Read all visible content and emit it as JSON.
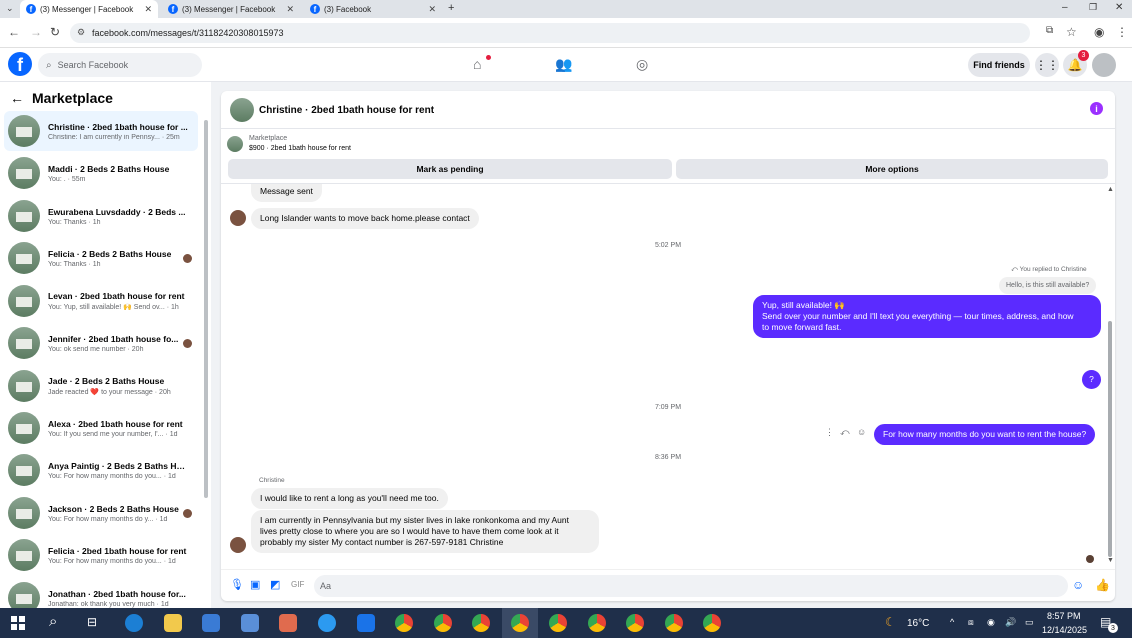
{
  "browser": {
    "tabs": [
      {
        "label": "(3) Messenger | Facebook"
      },
      {
        "label": "(3) Messenger | Facebook"
      },
      {
        "label": "(3) Facebook"
      }
    ],
    "url": "facebook.com/messages/t/31182420308015973"
  },
  "header": {
    "search_placeholder": "Search Facebook",
    "find_friends": "Find friends",
    "notification_count": "3"
  },
  "sidebar": {
    "title": "Marketplace",
    "conversations": [
      {
        "name": "Christine · 2bed 1bath house for ...",
        "preview": "Christine: I am currently in Pennsy... · 25m"
      },
      {
        "name": "Maddi · 2 Beds 2 Baths House",
        "preview": "You: . · 55m"
      },
      {
        "name": "Ewurabena Luvsdaddy · 2 Beds ...",
        "preview": "You: Thanks · 1h"
      },
      {
        "name": "Felicia · 2 Beds 2 Baths House",
        "preview": "You: Thanks · 1h"
      },
      {
        "name": "Levan · 2bed 1bath house for rent",
        "preview": "You: Yup, still available! 🙌 Send ov... · 1h"
      },
      {
        "name": "Jennifer · 2bed 1bath house fo...",
        "preview": "You: ok send me number · 20h"
      },
      {
        "name": "Jade · 2 Beds 2 Baths House",
        "preview": "Jade reacted ❤️ to your message · 20h"
      },
      {
        "name": "Alexa · 2bed 1bath house for rent",
        "preview": "You: If you send me your number, I'... · 1d"
      },
      {
        "name": "Anya Paintig · 2 Beds 2 Baths Ho...",
        "preview": "You: For how many months do you... · 1d"
      },
      {
        "name": "Jackson · 2 Beds 2 Baths House",
        "preview": "You: For how many months do y... · 1d"
      },
      {
        "name": "Felicia · 2bed 1bath house for rent",
        "preview": "You: For how many months do you... · 1d"
      },
      {
        "name": "Jonathan · 2bed 1bath house for...",
        "preview": "Jonathan: ok thank you very much · 1d"
      }
    ]
  },
  "chat": {
    "title": "Christine · 2bed 1bath house for rent",
    "listing_label": "Marketplace",
    "listing_detail": "$900 · 2bed 1bath house for rent",
    "mark_pending": "Mark as pending",
    "more_options": "More options",
    "messages": {
      "m1": "Message sent",
      "m2": "Long Islander wants to move back home.please contact",
      "ts1": "5:02 PM",
      "replied": "You replied to Christine",
      "quoted": "Hello, is this still available?",
      "m3_line1": "Yup, still available! 🙌",
      "m3_line2": "Send over your number and I'll text you everything — tour times, address, and how",
      "m3_line3": "to move forward fast.",
      "m4": "?",
      "ts2": "7:09 PM",
      "m5": "For how many months do you want to rent the house?",
      "ts3": "8:36 PM",
      "sender": "Christine",
      "m6": "I would like to rent a long as you'll need me too.",
      "m7_line1": "I am currently in Pennsylvania but my sister lives in lake ronkonkoma and my Aunt",
      "m7_line2": "lives pretty close to where you are so I would have to have them come look at it",
      "m7_line3": "probably my sister My contact number is 267-597-9181 Christine"
    },
    "composer_placeholder": "Aa"
  },
  "taskbar": {
    "temperature": "16°C",
    "time": "8:57 PM",
    "date": "12/14/2025",
    "notif": "3"
  },
  "colors": {
    "fb_blue": "#0866ff",
    "outgoing_bubble": "#5b2bff",
    "taskbar": "#1f2f4a"
  }
}
